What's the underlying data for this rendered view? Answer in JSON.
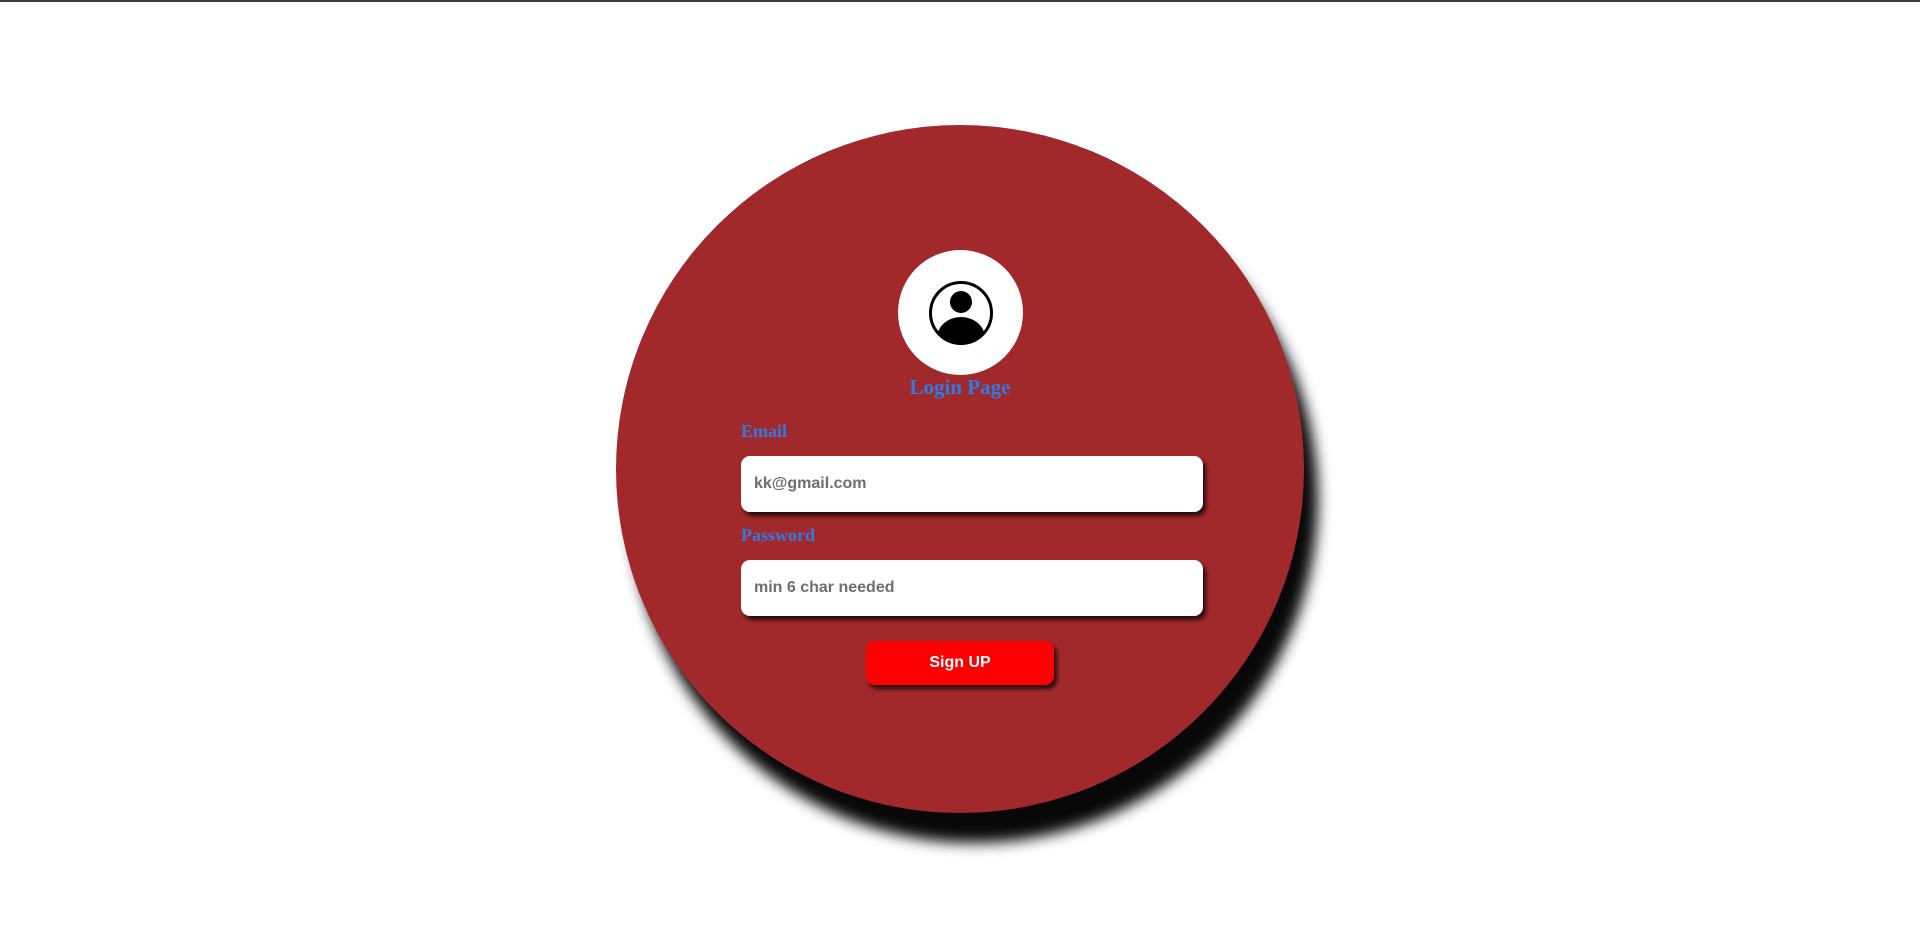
{
  "page": {
    "title": "Login Page"
  },
  "avatar": {
    "icon": "user-circle-icon"
  },
  "form": {
    "email": {
      "label": "Email",
      "placeholder": "kk@gmail.com",
      "value": ""
    },
    "password": {
      "label": "Password",
      "placeholder": "min 6 char needed",
      "value": ""
    },
    "submit_label": "Sign UP"
  },
  "colors": {
    "card": "#a2292b",
    "accent_text": "#2d7be5",
    "button": "#ff0000",
    "button_text": "#ffffff"
  }
}
